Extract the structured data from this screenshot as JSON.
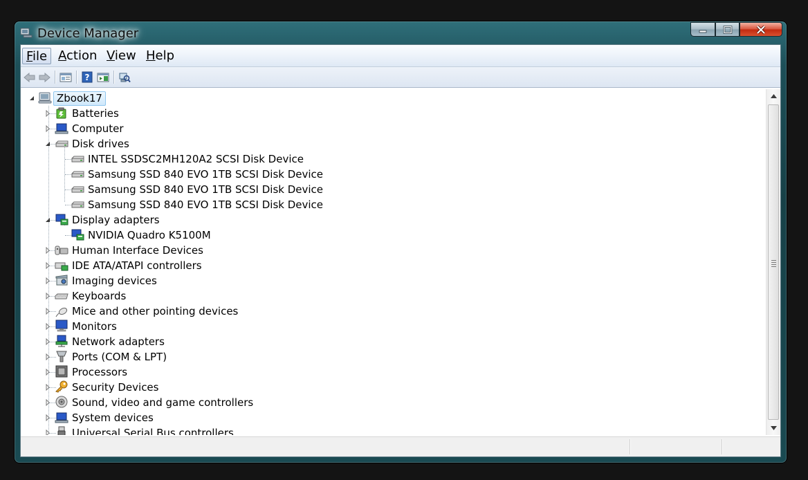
{
  "window": {
    "title": "Device Manager"
  },
  "menu": {
    "items": [
      {
        "label": "File",
        "key": "F",
        "rest": "ile"
      },
      {
        "label": "Action",
        "key": "A",
        "rest": "ction"
      },
      {
        "label": "View",
        "key": "V",
        "rest": "iew"
      },
      {
        "label": "Help",
        "key": "H",
        "rest": "elp"
      }
    ]
  },
  "toolbar": {
    "buttons": [
      "back-icon",
      "forward-icon",
      "properties-icon",
      "help-icon",
      "show-hide-console-tree-icon",
      "scan-hardware-icon"
    ]
  },
  "tree": {
    "root": "Zbook17",
    "nodes": [
      {
        "label": "Batteries",
        "icon": "battery-icon",
        "expanded": false
      },
      {
        "label": "Computer",
        "icon": "computer-icon",
        "expanded": false
      },
      {
        "label": "Disk drives",
        "icon": "disk-drive-icon",
        "expanded": true,
        "children": [
          "INTEL SSDSC2MH120A2 SCSI Disk Device",
          "Samsung SSD 840 EVO 1TB SCSI Disk Device",
          "Samsung SSD 840 EVO 1TB SCSI Disk Device",
          "Samsung SSD 840 EVO 1TB SCSI Disk Device"
        ]
      },
      {
        "label": "Display adapters",
        "icon": "display-adapter-icon",
        "expanded": true,
        "children": [
          "NVIDIA Quadro K5100M"
        ]
      },
      {
        "label": "Human Interface Devices",
        "icon": "hid-icon",
        "expanded": false
      },
      {
        "label": "IDE ATA/ATAPI controllers",
        "icon": "ide-controller-icon",
        "expanded": false
      },
      {
        "label": "Imaging devices",
        "icon": "imaging-device-icon",
        "expanded": false
      },
      {
        "label": "Keyboards",
        "icon": "keyboard-icon",
        "expanded": false
      },
      {
        "label": "Mice and other pointing devices",
        "icon": "mouse-icon",
        "expanded": false
      },
      {
        "label": "Monitors",
        "icon": "monitor-icon",
        "expanded": false
      },
      {
        "label": "Network adapters",
        "icon": "network-adapter-icon",
        "expanded": false
      },
      {
        "label": "Ports (COM & LPT)",
        "icon": "port-icon",
        "expanded": false
      },
      {
        "label": "Processors",
        "icon": "processor-icon",
        "expanded": false
      },
      {
        "label": "Security Devices",
        "icon": "security-device-icon",
        "expanded": false
      },
      {
        "label": "Sound, video and game controllers",
        "icon": "sound-icon",
        "expanded": false
      },
      {
        "label": "System devices",
        "icon": "system-device-icon",
        "expanded": false
      },
      {
        "label": "Universal Serial Bus controllers",
        "icon": "usb-icon",
        "expanded": false
      }
    ]
  },
  "colors": {
    "selection_bg": "#cfe8fb",
    "selection_border": "#8fc6ee"
  }
}
